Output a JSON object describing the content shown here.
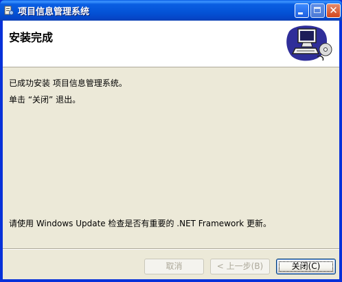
{
  "window": {
    "title": "项目信息管理系统",
    "icon": "installer-icon",
    "controls": {
      "minimize": "minimize-icon",
      "maximize": "maximize-icon",
      "close": "close-icon",
      "close_glyph": "✕"
    }
  },
  "header": {
    "title": "安装完成",
    "graphic": "computer-cd-icon"
  },
  "body": {
    "line1": "已成功安装 项目信息管理系统。",
    "line2": "单击 “关闭” 退出。",
    "line3": "请使用 Windows Update 检查是否有重要的 .NET Framework 更新。"
  },
  "buttons": {
    "cancel": "取消",
    "back": "< 上一步(B)",
    "close": "关闭(C)"
  },
  "colors": {
    "titlebar": "#0a5fe3",
    "face": "#ece9d8",
    "header_bg": "#ffffff",
    "disabled_text": "#aca899"
  }
}
